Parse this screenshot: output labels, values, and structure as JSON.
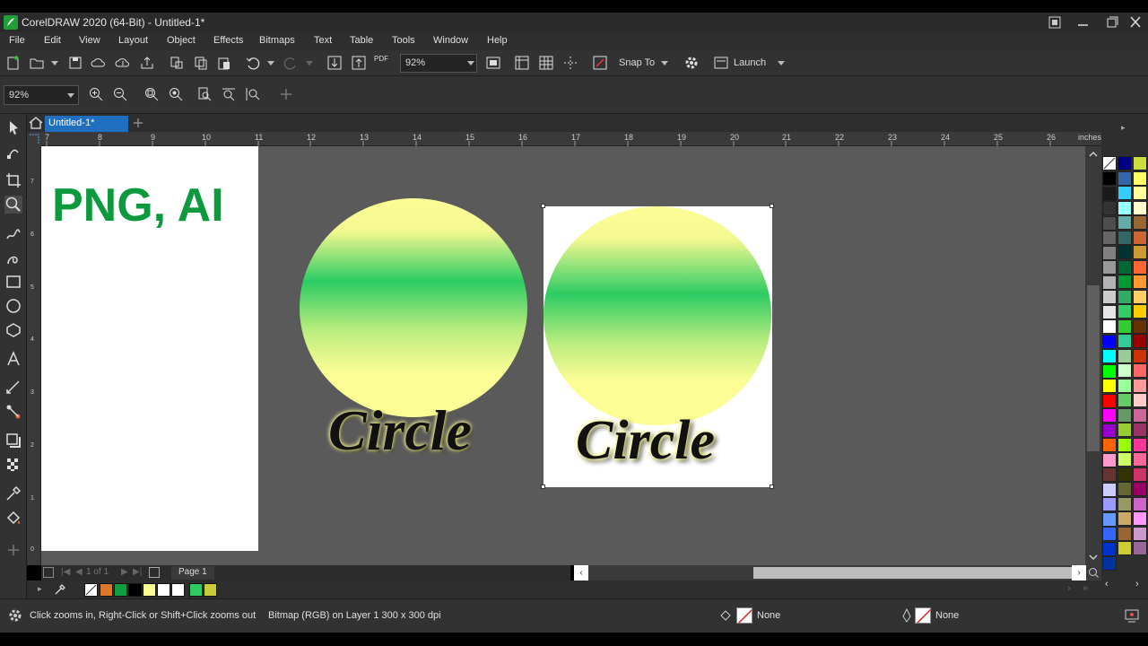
{
  "window": {
    "title": "CorelDRAW 2020 (64-Bit) - Untitled-1*"
  },
  "menu": [
    "File",
    "Edit",
    "View",
    "Layout",
    "Object",
    "Effects",
    "Bitmaps",
    "Text",
    "Table",
    "Tools",
    "Window",
    "Help"
  ],
  "toolbar": {
    "zoom_value": "92%",
    "pdf_label": "PDF",
    "snap_label": "Snap To",
    "launch_label": "Launch"
  },
  "propbar": {
    "zoom_value": "92%"
  },
  "tabs": {
    "document": "Untitled-1*"
  },
  "ruler": {
    "units": "inches",
    "h_labels": [
      "7",
      "8",
      "9",
      "10",
      "11",
      "12",
      "13",
      "14",
      "15",
      "16",
      "17",
      "18",
      "19",
      "20",
      "21",
      "22",
      "23",
      "24",
      "25",
      "26"
    ],
    "v_labels": [
      "7",
      "6",
      "5",
      "4",
      "3",
      "2",
      "1",
      "0"
    ]
  },
  "canvas": {
    "page_text": "PNG, AI",
    "page_partial_char": ":",
    "circle_label": "Circle",
    "gradient_colors": [
      "#fdfd96",
      "#2ccc63",
      "#fdfd96"
    ]
  },
  "page_nav": {
    "counter": "1 of 1",
    "page_tab": "Page 1"
  },
  "doc_palette": [
    "#ffffff",
    "#d9772a",
    "#10a040",
    "#000000",
    "#fdfd96",
    "#ffffff",
    "#ffffff",
    "#2ccc63",
    "#c8cc3a"
  ],
  "color_palette": {
    "col1": [
      "#000000",
      "#1a1a1a",
      "#333333",
      "#4d4d4d",
      "#666666",
      "#808080",
      "#999999",
      "#b3b3b3",
      "#cccccc",
      "#e6e6e6",
      "#ffffff",
      "#0000ff",
      "#00ffff",
      "#00ff00",
      "#ffff00",
      "#ff0000",
      "#ff00ff",
      "#9900cc",
      "#ff6600",
      "#ff99cc",
      "#663333",
      "#ccccff",
      "#9999ff",
      "#6699ff",
      "#3366ff",
      "#0033cc",
      "#003399"
    ],
    "col2": [
      "#000080",
      "#3366aa",
      "#33ccff",
      "#99ffff",
      "#66aaaa",
      "#336666",
      "#003333",
      "#006633",
      "#009933",
      "#33aa66",
      "#33cc66",
      "#33cc33",
      "#33cc99",
      "#99cc99",
      "#ccffcc",
      "#99ff99",
      "#66cc66",
      "#669966",
      "#99cc33",
      "#99ff00",
      "#ccff66",
      "#333300",
      "#666633",
      "#999966",
      "#ccaa66",
      "#996633",
      "#cccc33"
    ],
    "col3": [
      "#ccdd44",
      "#ffff66",
      "#ffff99",
      "#ffffcc",
      "#996633",
      "#cc6633",
      "#cc9933",
      "#ff6633",
      "#ff9933",
      "#ffcc66",
      "#ffcc00",
      "#663300",
      "#990000",
      "#cc3300",
      "#ff6666",
      "#ff9999",
      "#ffcccc",
      "#cc6699",
      "#993366",
      "#ff3399",
      "#ff6699",
      "#cc3366",
      "#990066",
      "#cc66cc",
      "#ff99ff",
      "#cc99cc",
      "#996699"
    ]
  },
  "status": {
    "hint": "Click zooms in, Right-Click or Shift+Click zooms out",
    "object_info": "Bitmap (RGB) on Layer 1 300 x 300 dpi",
    "fill": "None",
    "outline": "None"
  }
}
